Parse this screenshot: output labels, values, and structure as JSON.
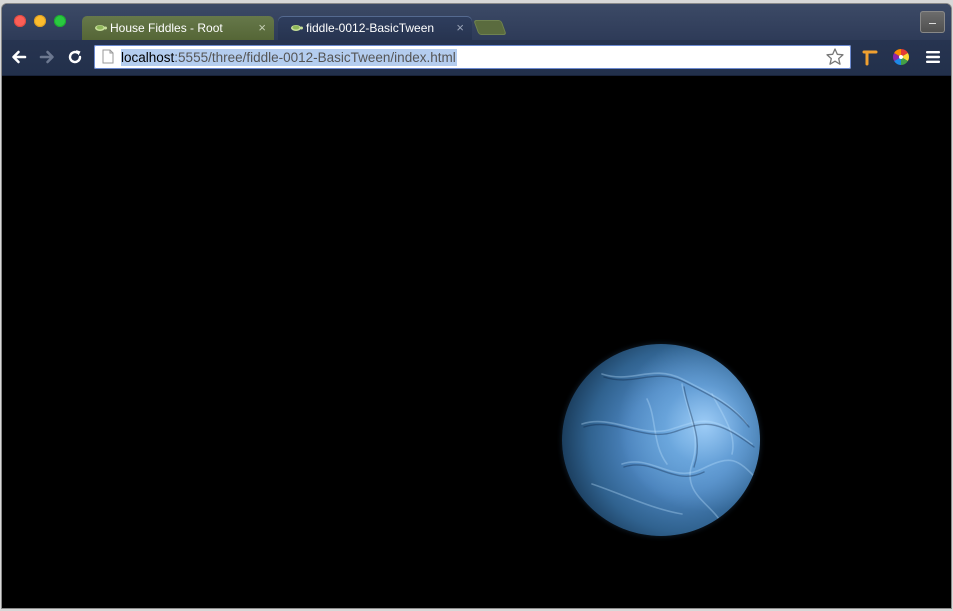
{
  "browser": {
    "tabs": [
      {
        "title": "House Fiddles - Root",
        "active": false
      },
      {
        "title": "fiddle-0012-BasicTween",
        "active": true
      }
    ],
    "close_glyph": "×",
    "address": {
      "host": "localhost",
      "rest": ":5555/three/fiddle-0012-BasicTween/index.html"
    }
  },
  "colors": {
    "tab_inactive": "#5a6b3e",
    "tab_active": "#2f3e5e",
    "toolbar": "#273450",
    "url_highlight": "#b4cdef",
    "planet": "#4a82bb"
  }
}
